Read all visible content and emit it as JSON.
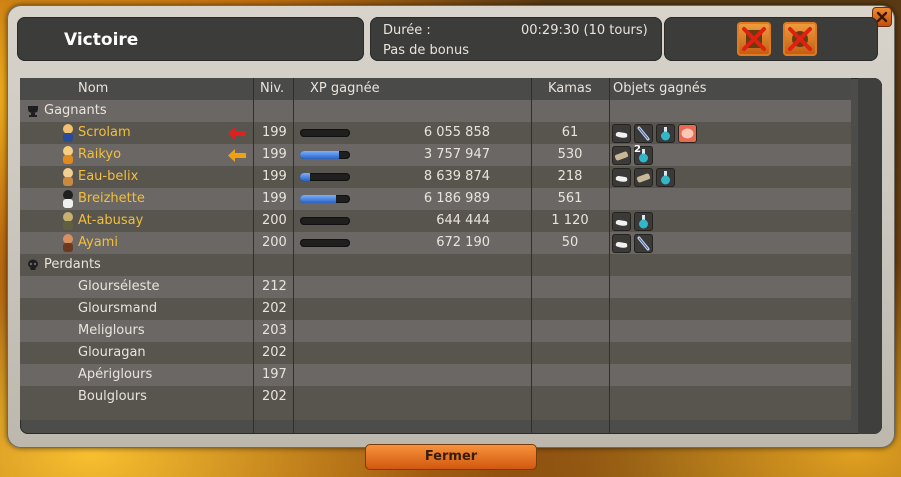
{
  "window": {
    "title": "Victoire",
    "duration_label": "Durée :",
    "duration_value": "00:29:30 (10 tours)",
    "bonus_label": "Pas de bonus",
    "close_button": "Fermer"
  },
  "table": {
    "headers": {
      "name": "Nom",
      "level": "Niv.",
      "xp": "XP gagnée",
      "kamas": "Kamas",
      "items": "Objets gagnés"
    },
    "winners_label": "Gagnants",
    "losers_label": "Perdants",
    "winners": [
      {
        "name": "Scrolam",
        "level": "199",
        "xp": "6 055 858",
        "xp_bar": 0.0,
        "kamas": "61",
        "items": [
          "bone",
          "feather",
          "potion",
          "meat"
        ],
        "arrow": "red"
      },
      {
        "name": "Raikyo",
        "level": "199",
        "xp": "3 757 947",
        "xp_bar": 0.78,
        "kamas": "530",
        "items": [
          "wood",
          "potion"
        ],
        "item_count_label": "2",
        "arrow": "orange"
      },
      {
        "name": "Eau-belix",
        "level": "199",
        "xp": "8 639 874",
        "xp_bar": 0.2,
        "kamas": "218",
        "items": [
          "bone",
          "wood",
          "potion"
        ]
      },
      {
        "name": "Breizhette",
        "level": "199",
        "xp": "6 186 989",
        "xp_bar": 0.72,
        "kamas": "561",
        "items": []
      },
      {
        "name": "At-abusay",
        "level": "200",
        "xp": "644 444",
        "xp_bar": 0.0,
        "kamas": "1 120",
        "items": [
          "bone",
          "potion"
        ]
      },
      {
        "name": "Ayami",
        "level": "200",
        "xp": "672 190",
        "xp_bar": 0.0,
        "kamas": "50",
        "items": [
          "bone",
          "feather"
        ]
      }
    ],
    "losers": [
      {
        "name": "Glourséleste",
        "level": "212"
      },
      {
        "name": "Gloursmand",
        "level": "202"
      },
      {
        "name": "Meliglours",
        "level": "203"
      },
      {
        "name": "Glouragan",
        "level": "202"
      },
      {
        "name": "Apériglours",
        "level": "197"
      },
      {
        "name": "Boulglours",
        "level": "202"
      }
    ]
  }
}
